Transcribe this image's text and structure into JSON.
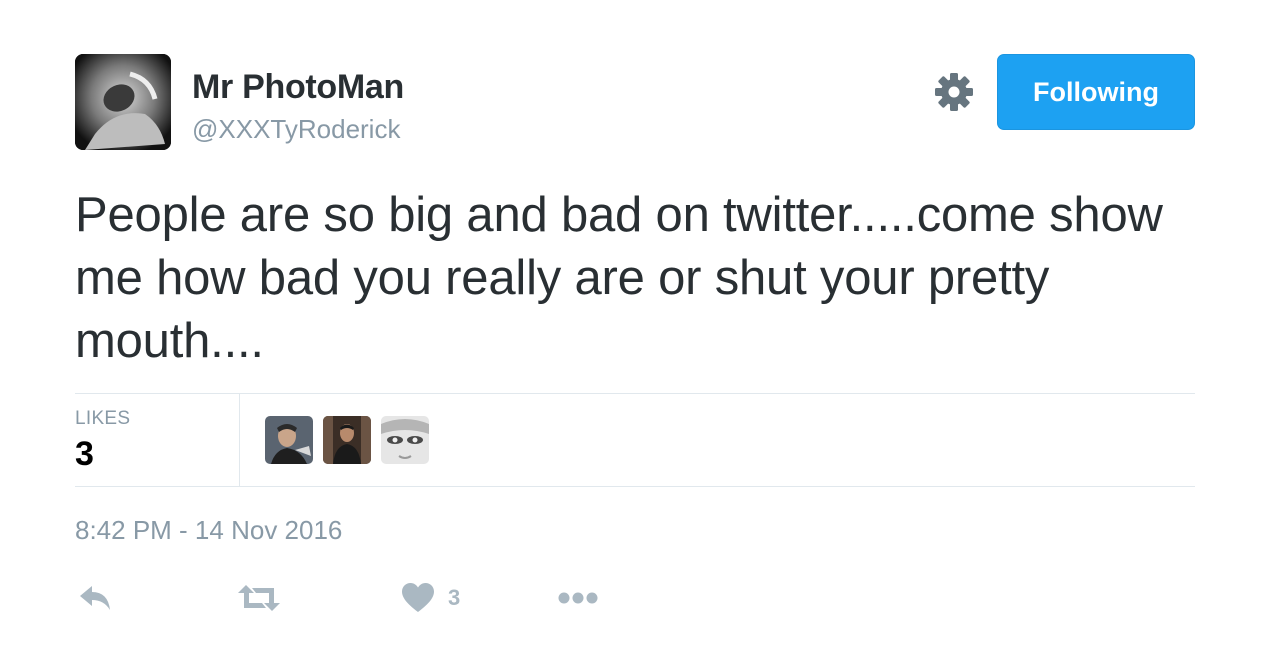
{
  "user": {
    "display_name": "Mr PhotoMan",
    "handle": "@XXXTyRoderick"
  },
  "follow_button": {
    "label": "Following"
  },
  "tweet": {
    "text": "People are so big and bad on twitter.....come show me how bad you really are or shut your pretty mouth....",
    "timestamp": "8:42 PM - 14 Nov 2016"
  },
  "stats": {
    "likes_label": "LIKES",
    "likes_count": "3"
  },
  "actions": {
    "like_count": "3"
  },
  "colors": {
    "accent": "#1da1f2",
    "muted": "#8899a6",
    "icon": "#aab8c2",
    "text": "#292f33"
  },
  "icons": [
    "gear-icon",
    "reply-icon",
    "retweet-icon",
    "heart-icon",
    "more-icon"
  ]
}
